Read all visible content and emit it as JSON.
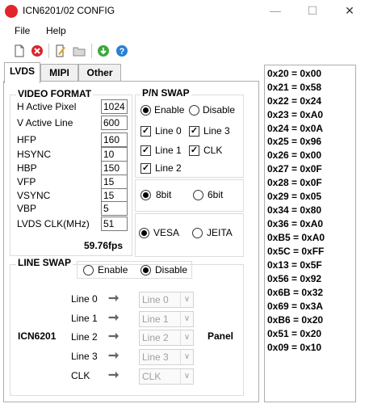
{
  "window": {
    "title": "ICN6201/02 CONFIG"
  },
  "window_buttons": {
    "minimize": "—",
    "maximize": "☐",
    "close": "✕"
  },
  "menu": [
    "File",
    "Help"
  ],
  "tabs": [
    "LVDS",
    "MIPI",
    "Other"
  ],
  "video_format": {
    "title": "VIDEO FORMAT",
    "fields": [
      {
        "label": "H Active Pixel",
        "value": "1024"
      },
      {
        "label": "V Active Line",
        "value": "600"
      },
      {
        "label": "HFP",
        "value": "160"
      },
      {
        "label": "HSYNC",
        "value": "10"
      },
      {
        "label": "HBP",
        "value": "150"
      },
      {
        "label": "VFP",
        "value": "15"
      },
      {
        "label": "VSYNC",
        "value": "15"
      },
      {
        "label": "VBP",
        "value": "5"
      },
      {
        "label": "LVDS CLK(MHz)",
        "value": "51"
      }
    ],
    "fps": "59.76fps"
  },
  "pn_swap": {
    "title": "P/N SWAP",
    "enable": "Enable",
    "disable": "Disable",
    "checks": [
      "Line 0",
      "Line 3",
      "Line 1",
      "CLK",
      "Line 2"
    ]
  },
  "bits": {
    "opt1": "8bit",
    "opt2": "6bit"
  },
  "mapping": {
    "opt1": "VESA",
    "opt2": "JEITA"
  },
  "line_swap": {
    "title": "LINE SWAP",
    "enable": "Enable",
    "disable": "Disable",
    "left_label": "ICN6201",
    "right_label": "Panel",
    "rows": [
      {
        "label": "Line 0",
        "selected": "Line 0"
      },
      {
        "label": "Line 1",
        "selected": "Line 1"
      },
      {
        "label": "Line 2",
        "selected": "Line 2"
      },
      {
        "label": "Line 3",
        "selected": "Line 3"
      },
      {
        "label": "CLK",
        "selected": "CLK"
      }
    ]
  },
  "registers": [
    "0x20 = 0x00",
    "0x21 = 0x58",
    "0x22 = 0x24",
    "0x23 = 0xA0",
    "0x24 = 0x0A",
    "0x25 = 0x96",
    "0x26 = 0x00",
    "0x27 = 0x0F",
    "0x28 = 0x0F",
    "0x29 = 0x05",
    "0x34 = 0x80",
    "0x36 = 0xA0",
    "0xB5 = 0xA0",
    "0x5C = 0xFF",
    "0x13 = 0x5F",
    "0x56 = 0x92",
    "0x6B = 0x32",
    "0x69 = 0x3A",
    "0xB6 = 0x20",
    "0x51 = 0x20",
    "0x09 = 0x10"
  ]
}
